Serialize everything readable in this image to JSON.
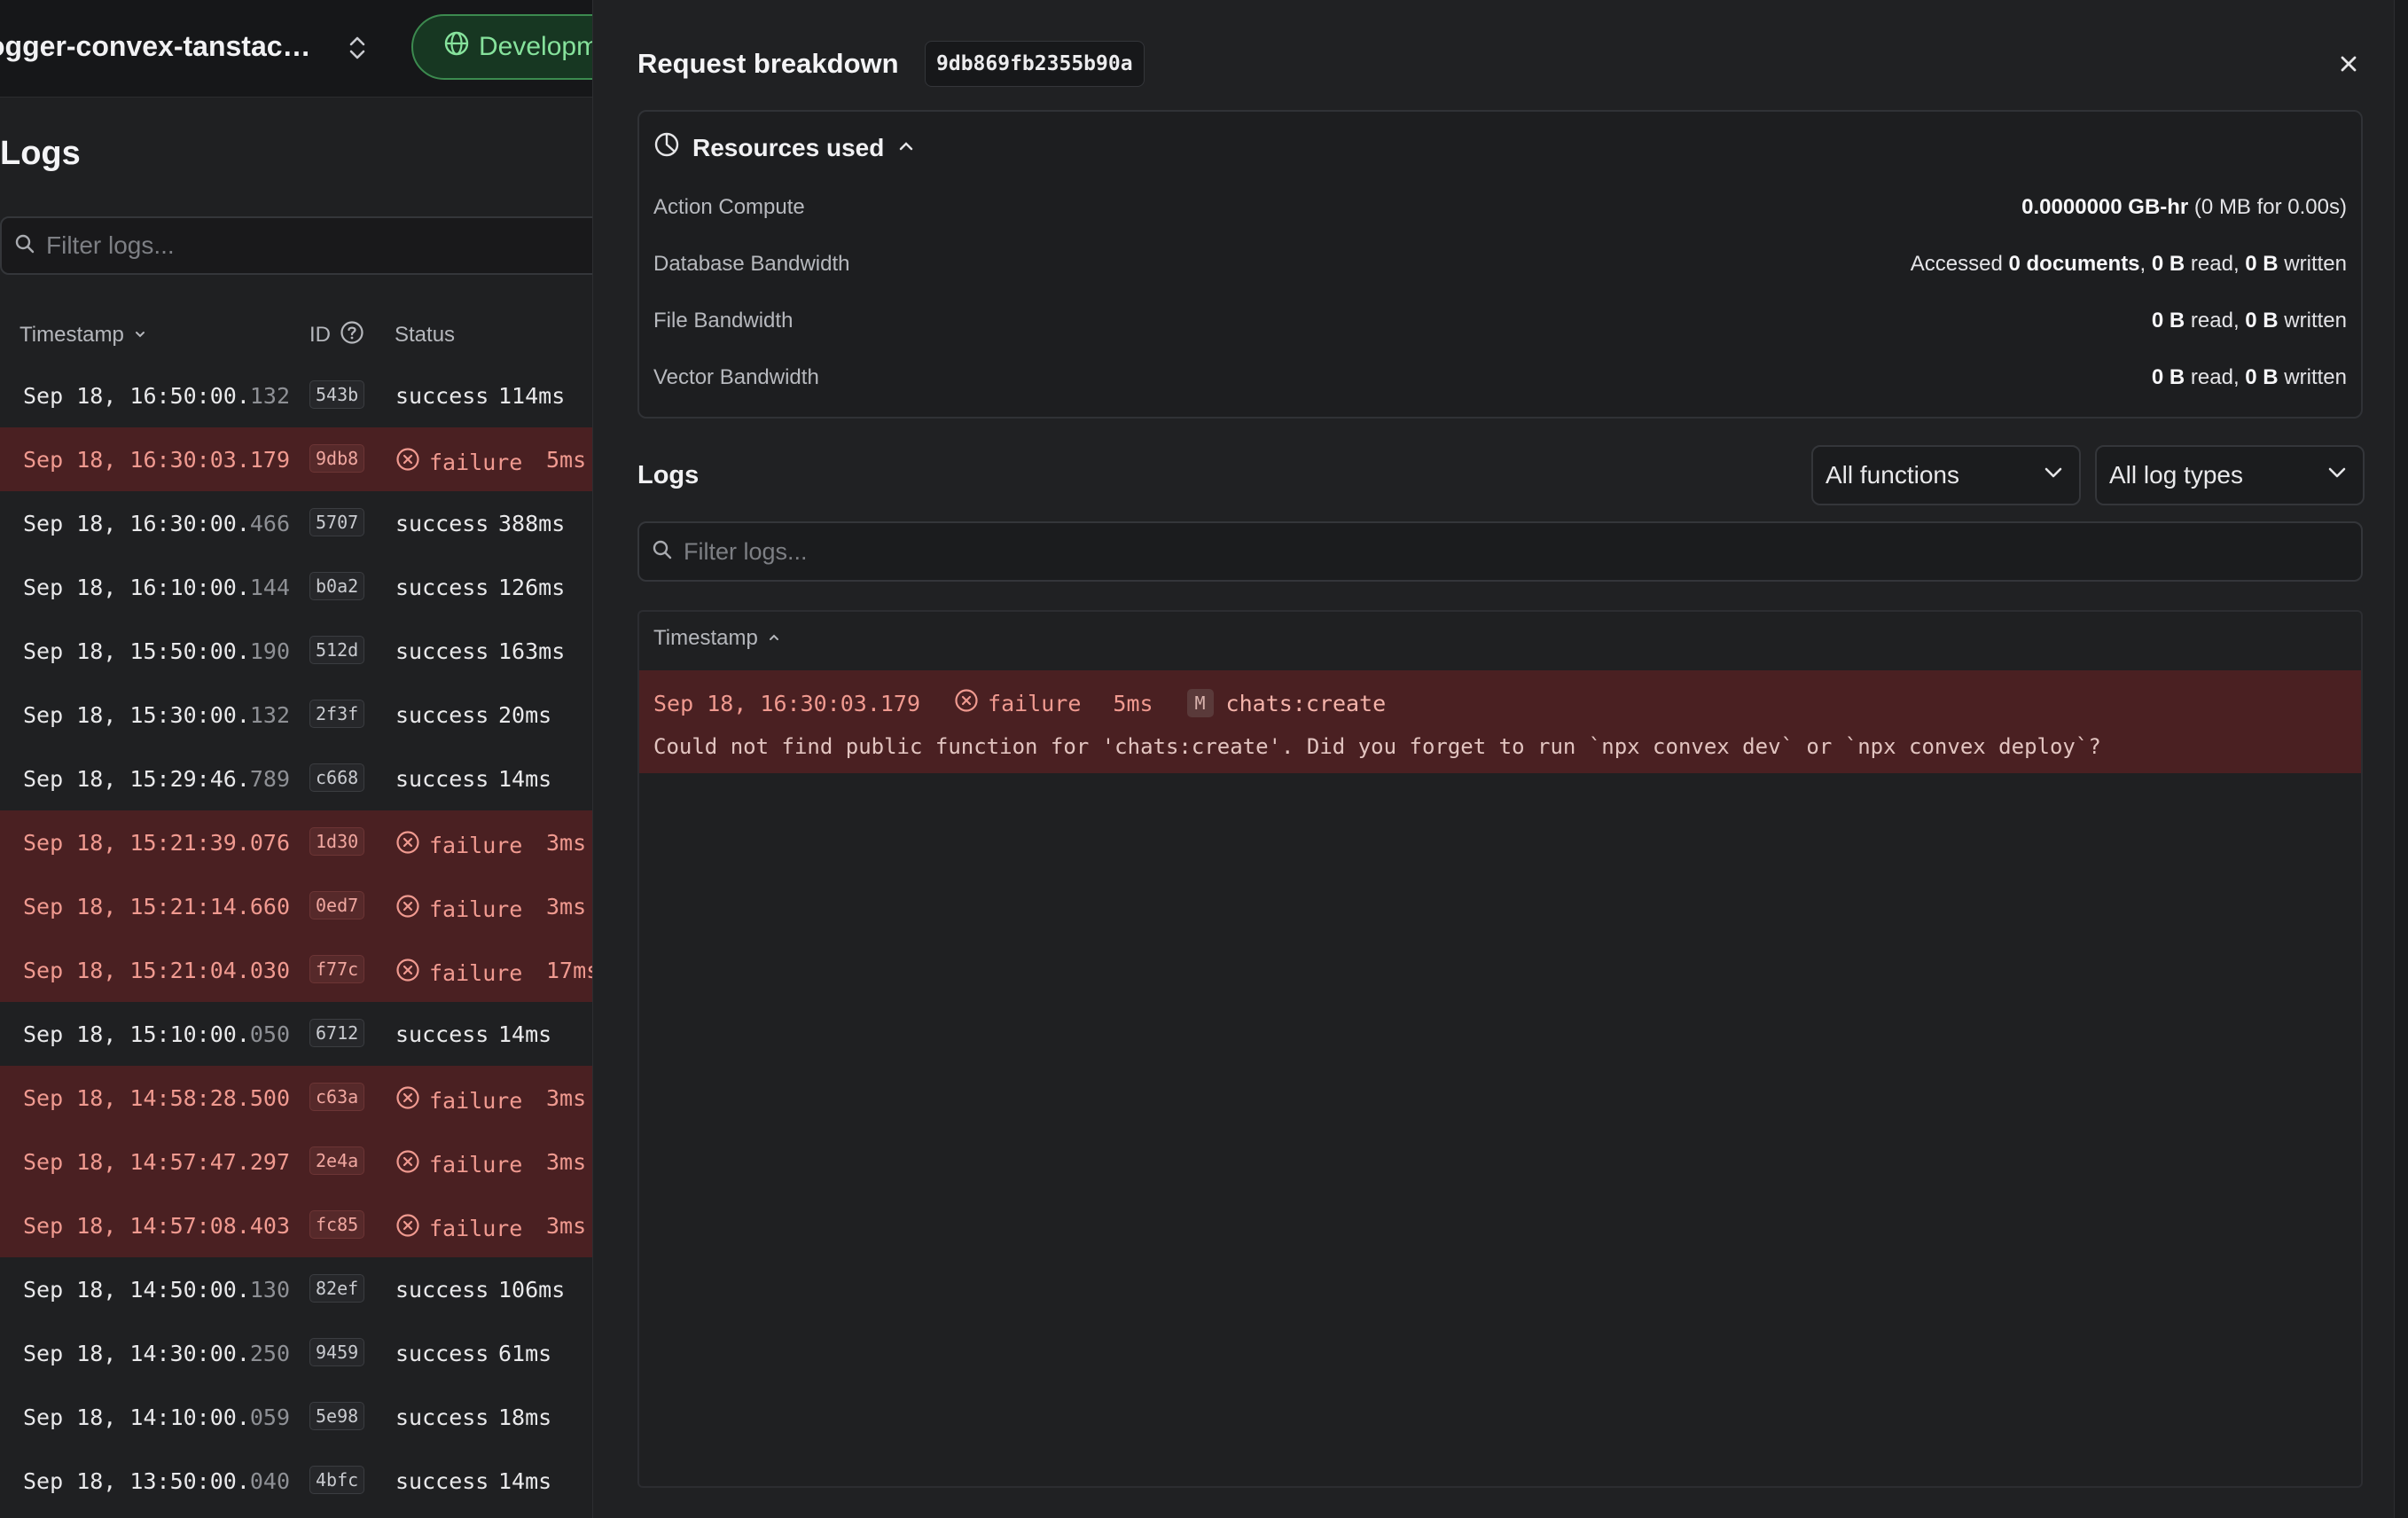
{
  "left": {
    "project_name": "ogger-convex-tanstac…",
    "environment_label": "Developm",
    "page_title": "Logs",
    "filter_placeholder": "Filter logs...",
    "columns": {
      "timestamp": "Timestamp",
      "id": "ID",
      "status": "Status"
    },
    "rows": [
      {
        "ts_main": "Sep 18, 16:50:00.",
        "ts_ms": "132",
        "id": "543b",
        "status": "success",
        "duration": "114ms",
        "failed": false
      },
      {
        "ts_main": "Sep 18, 16:30:03.",
        "ts_ms": "179",
        "id": "9db8",
        "status": "failure",
        "duration": "5ms",
        "failed": true
      },
      {
        "ts_main": "Sep 18, 16:30:00.",
        "ts_ms": "466",
        "id": "5707",
        "status": "success",
        "duration": "388ms",
        "failed": false
      },
      {
        "ts_main": "Sep 18, 16:10:00.",
        "ts_ms": "144",
        "id": "b0a2",
        "status": "success",
        "duration": "126ms",
        "failed": false
      },
      {
        "ts_main": "Sep 18, 15:50:00.",
        "ts_ms": "190",
        "id": "512d",
        "status": "success",
        "duration": "163ms",
        "failed": false
      },
      {
        "ts_main": "Sep 18, 15:30:00.",
        "ts_ms": "132",
        "id": "2f3f",
        "status": "success",
        "duration": "20ms",
        "failed": false
      },
      {
        "ts_main": "Sep 18, 15:29:46.",
        "ts_ms": "789",
        "id": "c668",
        "status": "success",
        "duration": "14ms",
        "failed": false
      },
      {
        "ts_main": "Sep 18, 15:21:39.",
        "ts_ms": "076",
        "id": "1d30",
        "status": "failure",
        "duration": "3ms",
        "failed": true
      },
      {
        "ts_main": "Sep 18, 15:21:14.",
        "ts_ms": "660",
        "id": "0ed7",
        "status": "failure",
        "duration": "3ms",
        "failed": true
      },
      {
        "ts_main": "Sep 18, 15:21:04.",
        "ts_ms": "030",
        "id": "f77c",
        "status": "failure",
        "duration": "17ms",
        "failed": true
      },
      {
        "ts_main": "Sep 18, 15:10:00.",
        "ts_ms": "050",
        "id": "6712",
        "status": "success",
        "duration": "14ms",
        "failed": false
      },
      {
        "ts_main": "Sep 18, 14:58:28.",
        "ts_ms": "500",
        "id": "c63a",
        "status": "failure",
        "duration": "3ms",
        "failed": true
      },
      {
        "ts_main": "Sep 18, 14:57:47.",
        "ts_ms": "297",
        "id": "2e4a",
        "status": "failure",
        "duration": "3ms",
        "failed": true
      },
      {
        "ts_main": "Sep 18, 14:57:08.",
        "ts_ms": "403",
        "id": "fc85",
        "status": "failure",
        "duration": "3ms",
        "failed": true
      },
      {
        "ts_main": "Sep 18, 14:50:00.",
        "ts_ms": "130",
        "id": "82ef",
        "status": "success",
        "duration": "106ms",
        "failed": false
      },
      {
        "ts_main": "Sep 18, 14:30:00.",
        "ts_ms": "250",
        "id": "9459",
        "status": "success",
        "duration": "61ms",
        "failed": false
      },
      {
        "ts_main": "Sep 18, 14:10:00.",
        "ts_ms": "059",
        "id": "5e98",
        "status": "success",
        "duration": "18ms",
        "failed": false
      },
      {
        "ts_main": "Sep 18, 13:50:00.",
        "ts_ms": "040",
        "id": "4bfc",
        "status": "success",
        "duration": "14ms",
        "failed": false
      }
    ]
  },
  "panel": {
    "title": "Request breakdown",
    "request_id": "9db869fb2355b90a",
    "resources": {
      "heading": "Resources used",
      "action_compute": {
        "label": "Action Compute",
        "value_bold": "0.0000000 GB-hr",
        "value_rest": " (0 MB for 0.00s)"
      },
      "database_bandwidth": {
        "label": "Database Bandwidth",
        "prefix": "Accessed ",
        "documents": "0 documents",
        "sep1": ", ",
        "read": "0 B",
        "read_word": " read, ",
        "written": "0 B",
        "written_word": " written"
      },
      "file_bandwidth": {
        "label": "File Bandwidth",
        "read": "0 B",
        "read_word": " read, ",
        "written": "0 B",
        "written_word": " written"
      },
      "vector_bandwidth": {
        "label": "Vector Bandwidth",
        "read": "0 B",
        "read_word": " read, ",
        "written": "0 B",
        "written_word": " written"
      }
    },
    "logs": {
      "title": "Logs",
      "functions_dropdown": "All functions",
      "types_dropdown": "All log types",
      "filter_placeholder": "Filter logs...",
      "timestamp_header": "Timestamp",
      "entry": {
        "timestamp": "Sep 18, 16:30:03.179",
        "status": "failure",
        "duration": "5ms",
        "kind_badge": "M",
        "function": "chats:create",
        "message": "Could not find public function for 'chats:create'. Did you forget to run `npx convex dev` or `npx convex deploy`?"
      }
    }
  },
  "colors": {
    "failure_row_bg": "#4a2022",
    "failure_text": "#f09a90",
    "env_badge_green": "#86e29c",
    "panel_bg": "#202123"
  },
  "icons": [
    "chevron-up-down-icon",
    "globe-icon",
    "search-icon",
    "chevron-down-icon",
    "help-circle-icon",
    "x-circle-icon",
    "close-icon",
    "pie-chart-icon",
    "chevron-up-icon"
  ]
}
